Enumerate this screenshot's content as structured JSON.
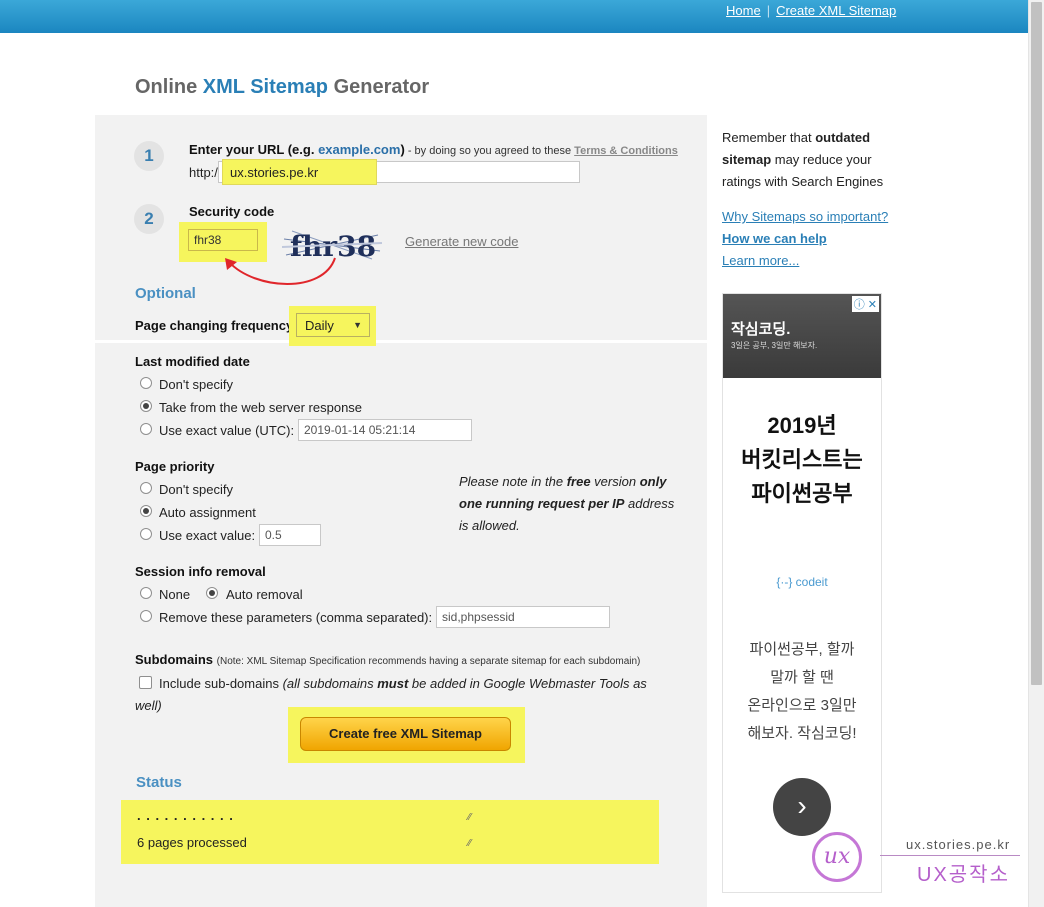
{
  "topnav": {
    "home": "Home",
    "create": "Create XML Sitemap"
  },
  "title": {
    "part1": "Online ",
    "part2": "XML Sitemap",
    "part3": " Generator"
  },
  "step1": {
    "number": "1",
    "label_bold": "Enter your URL (e.g. ",
    "example": "example.com",
    "label_close": ")",
    "agree_text": " - by doing so you agreed to these ",
    "terms_link": "Terms & Conditions",
    "prefix": "http://",
    "url_value": "ux.stories.pe.kr"
  },
  "step2": {
    "number": "2",
    "label": "Security code",
    "code_value": "fhr38",
    "captcha_text": "fhr38",
    "generate_link": "Generate new code"
  },
  "optional": {
    "heading": "Optional",
    "freq_label": "Page changing frequency",
    "freq_value": "Daily"
  },
  "last_modified": {
    "heading": "Last modified date",
    "opt1": "Don't specify",
    "opt2": "Take from the web server response",
    "opt3": "Use exact value (UTC):",
    "exact_value": "2019-01-14 05:21:14",
    "selected": 2
  },
  "priority": {
    "heading": "Page priority",
    "opt1": "Don't specify",
    "opt2": "Auto assignment",
    "opt3": "Use exact value:",
    "exact_value": "0.5",
    "note_1": "Please note in the ",
    "note_free": "free",
    "note_2": " version ",
    "note_only": "only",
    "note_one": "one running request per IP",
    "note_3": " address",
    "note_4": "is allowed."
  },
  "session": {
    "heading": "Session info removal",
    "opt_none": "None",
    "opt_auto": "Auto removal",
    "opt_remove": "Remove these parameters (comma separated):",
    "params_value": "sid,phpsessid"
  },
  "subdomains": {
    "heading": "Subdomains",
    "note": "(Note: XML Sitemap Specification recommends having a separate sitemap for each subdomain)",
    "checkbox_label": "Include sub-domains",
    "italic_1": "(all subdomains ",
    "italic_must": "must",
    "italic_2": " be added in Google Webmaster Tools as",
    "italic_3": "well)"
  },
  "cta_label": "Create free XML Sitemap",
  "status": {
    "heading": "Status",
    "dots": ". . . . . . . . . . .",
    "message": "6 pages processed"
  },
  "sidebar": {
    "line1_a": "Remember that ",
    "line1_b": "outdated",
    "line2_a": "sitemap",
    "line2_b": " may reduce your",
    "line3": "ratings with Search Engines",
    "link_why": "Why Sitemaps so important?",
    "link_how": "How we can help",
    "link_learn": "Learn more..."
  },
  "ad": {
    "top_title": "작심코딩.",
    "top_sub": "3일은 공부, 3일만 해보자.",
    "badges": "ⓘ ✕",
    "big_1": "2019년",
    "big_2": "버킷리스트는",
    "big_3": "파이썬공부",
    "brand": "{·-} codeit",
    "body_1": "파이썬공부, 할까",
    "body_2": "말까 할 땐",
    "body_3": "온라인으로 3일만",
    "body_4": "해보자. 작심코딩!"
  },
  "watermark": {
    "logo": "ux",
    "url": "ux.stories.pe.kr",
    "name": "UX공작소"
  },
  "colors": {
    "accent": "#2a7fb6",
    "highlight": "#f6f55d",
    "cta": "#f0a500",
    "annotation_arrow": "#e0262b"
  }
}
